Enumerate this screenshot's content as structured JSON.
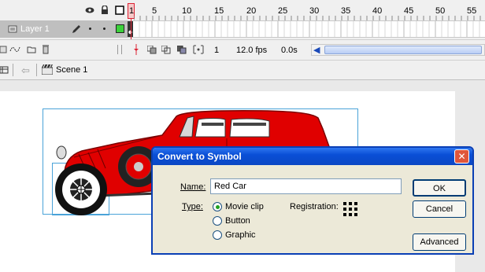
{
  "timeline": {
    "layer_name": "Layer 1",
    "frame_numbers": [
      "1",
      "5",
      "10",
      "15",
      "20",
      "25",
      "30",
      "35",
      "40",
      "45",
      "50",
      "55"
    ],
    "status": {
      "current_frame": "1",
      "frame_rate": "12.0 fps",
      "elapsed_time": "0.0s"
    }
  },
  "editbar": {
    "scene_label": "Scene 1"
  },
  "dialog": {
    "title": "Convert to Symbol",
    "close_glyph": "✕",
    "name_label": "Name:",
    "name_value": "Red Car",
    "type_label": "Type:",
    "type_options": [
      {
        "label": "Movie clip",
        "selected": true
      },
      {
        "label": "Button",
        "selected": false
      },
      {
        "label": "Graphic",
        "selected": false
      }
    ],
    "registration_label": "Registration:",
    "buttons": {
      "ok": "OK",
      "cancel": "Cancel",
      "advanced": "Advanced"
    }
  },
  "colors": {
    "car_red": "#e00000",
    "title_bar": "#0a4fd6",
    "dialog_bg": "#ece9d8"
  },
  "icons": [
    "eye-icon",
    "lock-icon",
    "outline-icon",
    "pencil-icon",
    "trash-icon",
    "back-arrow-icon",
    "scene-clapper-icon",
    "onion-skin-icon"
  ]
}
